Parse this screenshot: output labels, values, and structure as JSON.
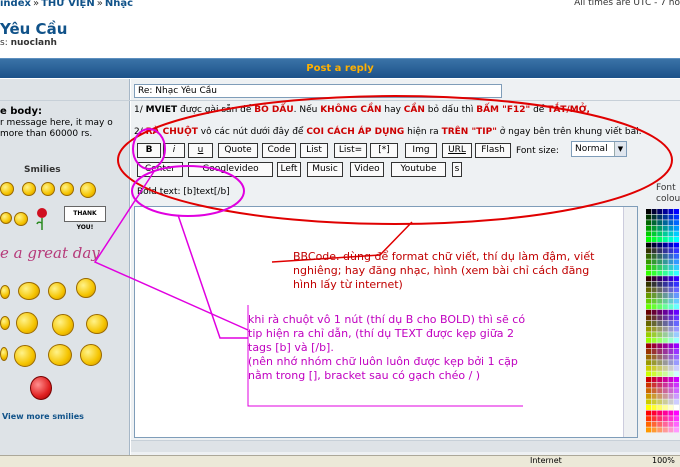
{
  "topbar": {
    "breadcrumb": [
      "index",
      "THƯ VIỆN",
      "Nhạc"
    ],
    "separator": "»",
    "timezone": "All times are UTC - 7 ho"
  },
  "forum": {
    "title": "Yêu Cầu",
    "moderator_label": "s:",
    "moderator_name": "nuoclanh"
  },
  "header": {
    "title": "Post a reply"
  },
  "form": {
    "subject_label": "",
    "subject_value": "Re: Nhạc Yêu Cầu",
    "body_label": "e body:",
    "body_desc": "r message here, it may o more than 60000 rs.",
    "smilies_title": "Smilies",
    "view_more": "View more smilies",
    "greatday": "e a great day",
    "thank_text": "THANK YOU!"
  },
  "instructions": {
    "line1_prefix": "1/ ",
    "line1_bold1": "MVIET",
    "line1_mid1": " được gài sẵn để ",
    "line1_bold2": "BỎ DẤU",
    "line1_mid2": ". Nếu ",
    "line1_bold3": "KHÔNG CẦN",
    "line1_mid3": " hay ",
    "line1_bold4": "CẦN",
    "line1_mid4": " bỏ dấu thì ",
    "line1_bold5": "BẤM \"F12\"",
    "line1_mid5": " để ",
    "line1_bold6": "TẮT/MỞ,",
    "line2_prefix": "2/ ",
    "line2_bold1": "RÀ CHUỘT",
    "line2_mid1": " vô các nút dưới đây để ",
    "line2_bold2": "COI CÁCH ÁP DỤNG",
    "line2_mid2": " hiện ra ",
    "line2_bold3": "TRÊN \"TIP\"",
    "line2_mid3": " ở ngay bên trên khung viết bài:"
  },
  "bbcode": {
    "row1": [
      "B",
      "i",
      "u",
      "Quote",
      "Code",
      "List",
      "List=",
      "[*]",
      "Img",
      "URL",
      "Flash"
    ],
    "row2": [
      "Center",
      "Googlevideo",
      "Left",
      "Music",
      "Video",
      "Youtube",
      "s"
    ],
    "font_size_label": "Font size:",
    "font_size_value": "Normal"
  },
  "helpline": "Bold text: [b]text[/b]",
  "font_colour_label": [
    "Font",
    "colou"
  ],
  "annotations": {
    "red_note": "BBCode. dùng để format chữ viết, thí dụ làm đậm, viết nghiêng; hay đăng nhạc, hình (xem bài chỉ cách đăng hình lấy từ internet)",
    "purple_note_1": "khi rà chuột vô 1 nút (thí dụ B cho BOLD) thì sẽ có tip hiện ra chỉ dẫn, (thí dụ TEXT được kẹp giữa 2 tags [b] và [/b].",
    "purple_note_2": "(nên nhớ nhóm chữ luôn luôn được kẹp bởi 1 cặp nằm trong [], bracket sau có gạch chéo / )"
  },
  "statusbar": {
    "zone": "Internet",
    "zoom": "100%"
  },
  "colors": {
    "link": "#105289",
    "header_bar": "#1c5189",
    "header_text": "#ffb000",
    "annotation_red": "#e00000",
    "annotation_purple": "#e000e0"
  }
}
